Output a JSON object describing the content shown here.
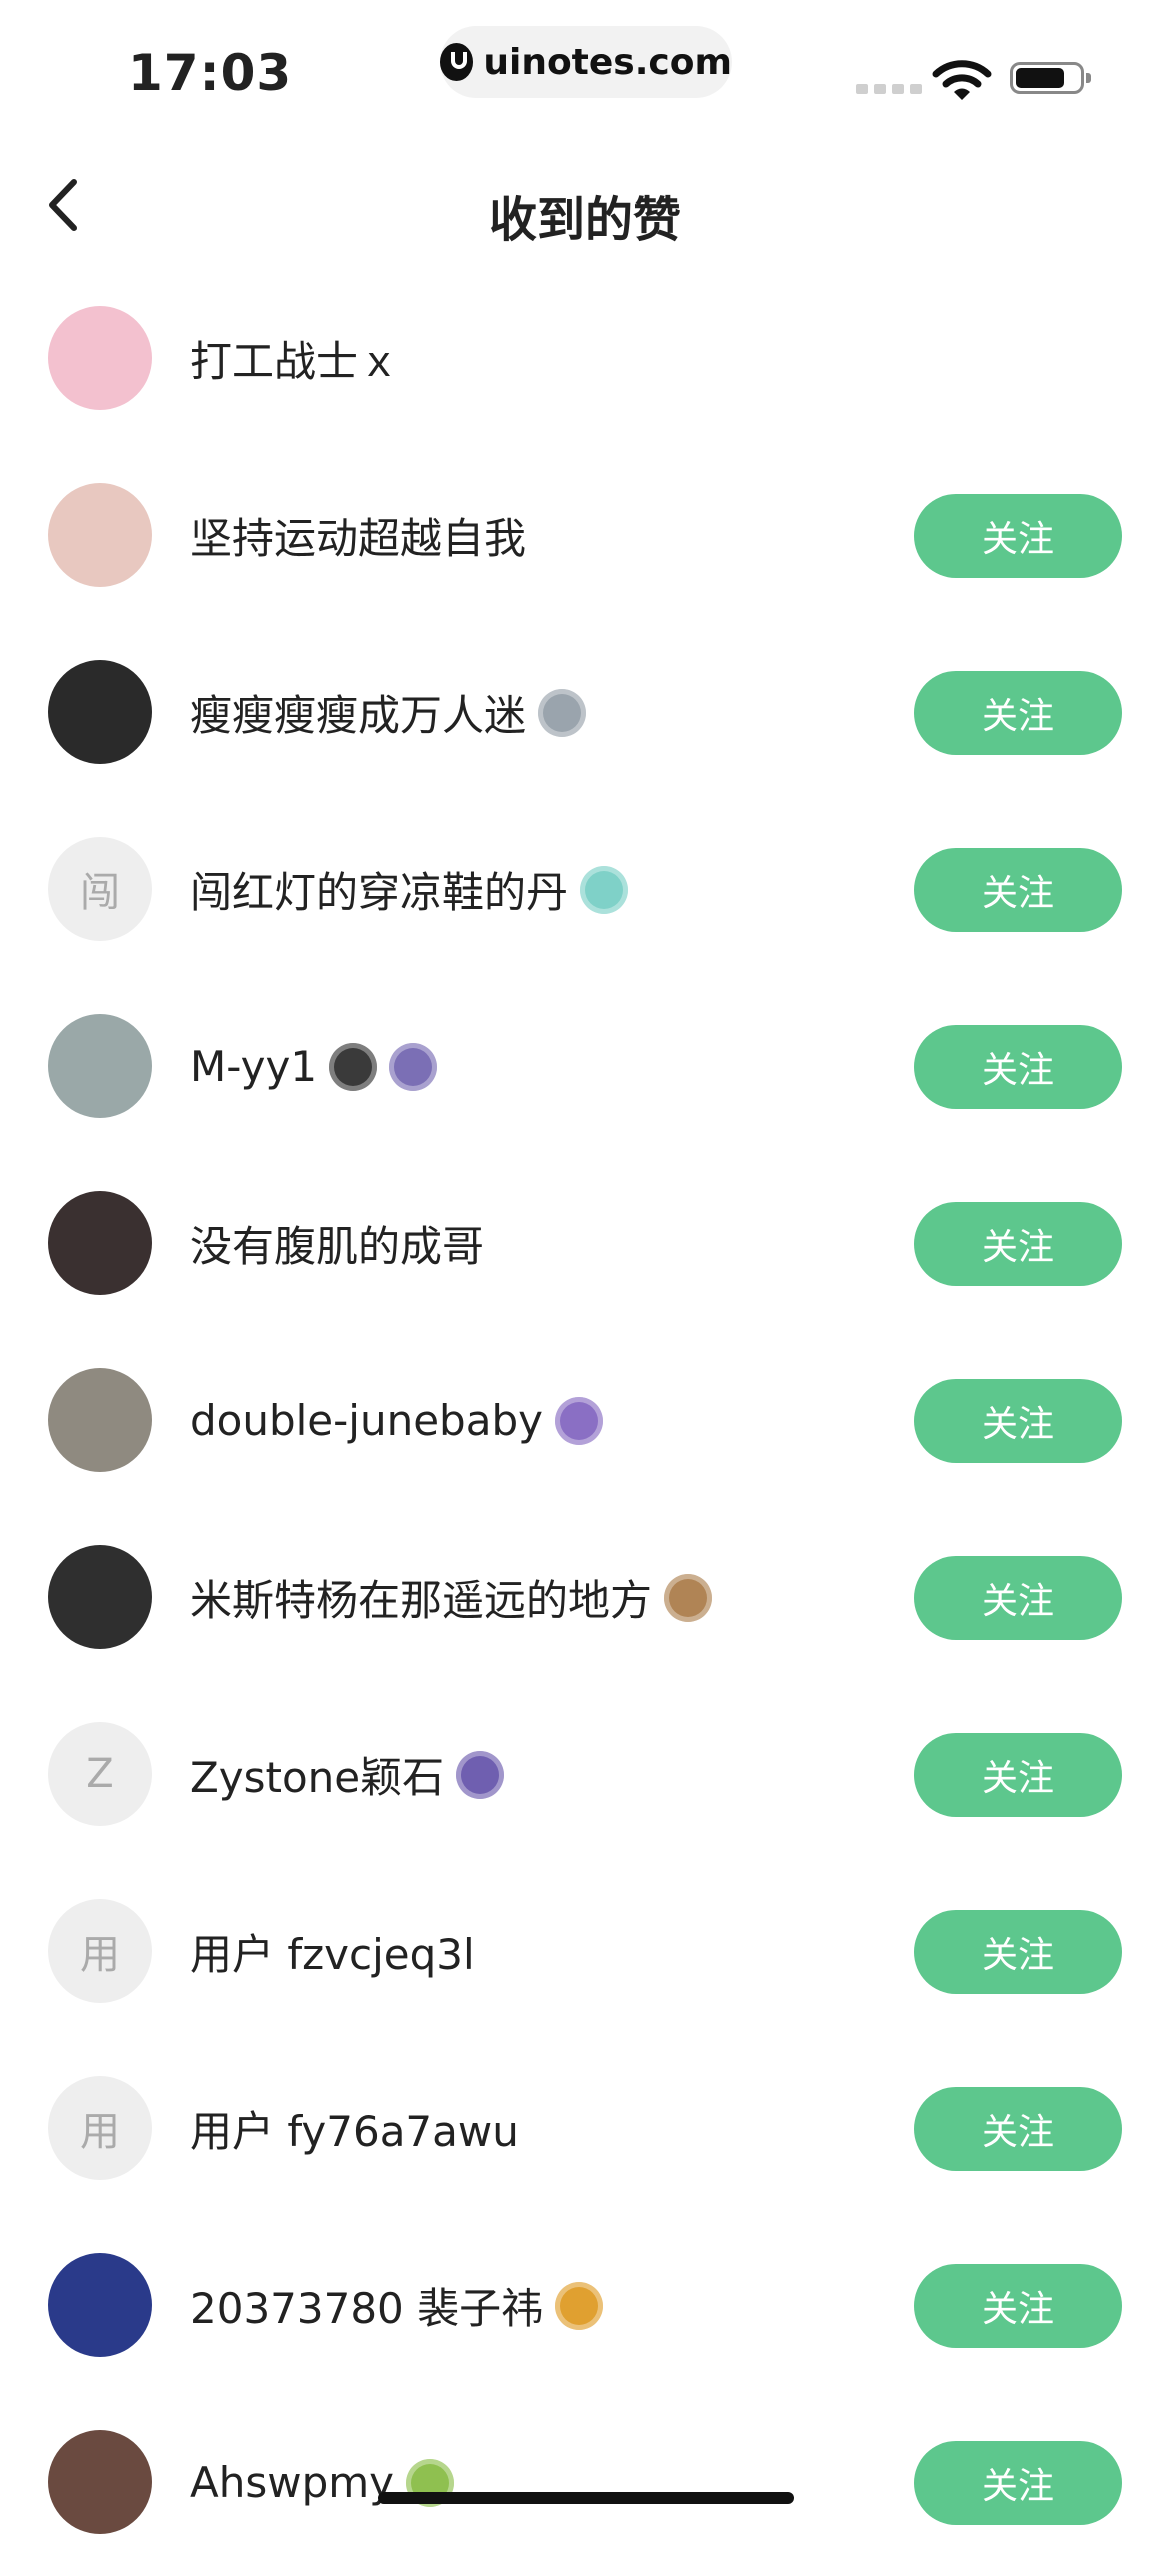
{
  "status_bar": {
    "time": "17:03",
    "url": "uinotes.com"
  },
  "header": {
    "title": "收到的赞"
  },
  "follow_label": "关注",
  "items": [
    {
      "name": "打工战士ｘ",
      "avatar_text": "",
      "avatar_color": "#f3c1cf",
      "badges": [],
      "show_follow": false
    },
    {
      "name": "坚持运动超越自我",
      "avatar_text": "",
      "avatar_color": "#e8c8c0",
      "badges": [],
      "show_follow": true
    },
    {
      "name": "瘦瘦瘦瘦成万人迷",
      "avatar_text": "",
      "avatar_color": "#2a2a2a",
      "badges": [
        "#9aa4ad"
      ],
      "show_follow": true
    },
    {
      "name": "闯红灯的穿凉鞋的丹",
      "avatar_text": "闯",
      "avatar_color": "#eeeeee",
      "badges": [
        "#7fd1c8"
      ],
      "show_follow": true
    },
    {
      "name": "M-yy1",
      "avatar_text": "",
      "avatar_color": "#9aa8a8",
      "badges": [
        "#3a3a3a",
        "#7b6fb5"
      ],
      "show_follow": true
    },
    {
      "name": "没有腹肌的成哥",
      "avatar_text": "",
      "avatar_color": "#3a3030",
      "badges": [],
      "show_follow": true
    },
    {
      "name": "double-junebaby",
      "avatar_text": "",
      "avatar_color": "#8f8a80",
      "badges": [
        "#8a6fc4"
      ],
      "show_follow": true
    },
    {
      "name": "米斯特杨在那遥远的地方",
      "avatar_text": "",
      "avatar_color": "#2f2f2f",
      "badges": [
        "#b08455"
      ],
      "show_follow": true
    },
    {
      "name": "Zystone颖石",
      "avatar_text": "Z",
      "avatar_color": "#eeeeee",
      "badges": [
        "#6f5fb0"
      ],
      "show_follow": true
    },
    {
      "name": "用户 fzvcjeq3l",
      "avatar_text": "用",
      "avatar_color": "#eeeeee",
      "badges": [],
      "show_follow": true
    },
    {
      "name": "用户 fy76a7awu",
      "avatar_text": "用",
      "avatar_color": "#eeeeee",
      "badges": [],
      "show_follow": true
    },
    {
      "name": "20373780 裴子祎",
      "avatar_text": "",
      "avatar_color": "#2a3a8a",
      "badges": [
        "#e0a030"
      ],
      "show_follow": true
    },
    {
      "name": "Ahswpmy",
      "avatar_text": "",
      "avatar_color": "#6a4a40",
      "badges": [
        "#8fc050"
      ],
      "show_follow": true
    }
  ]
}
